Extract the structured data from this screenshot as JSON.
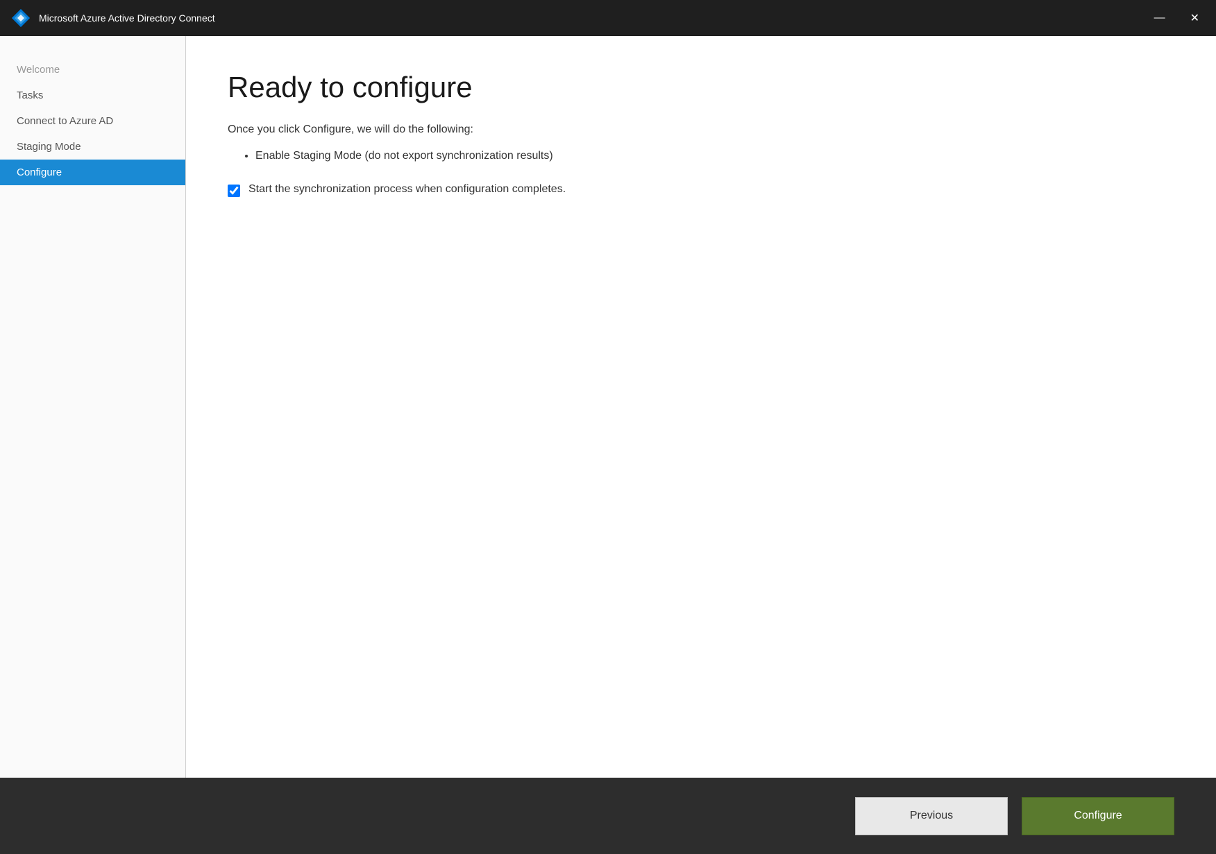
{
  "titlebar": {
    "logo_alt": "Azure AD Connect Logo",
    "title": "Microsoft Azure Active Directory Connect",
    "minimize_label": "—",
    "close_label": "✕"
  },
  "sidebar": {
    "items": [
      {
        "id": "welcome",
        "label": "Welcome",
        "state": "muted"
      },
      {
        "id": "tasks",
        "label": "Tasks",
        "state": "normal"
      },
      {
        "id": "connect-azure-ad",
        "label": "Connect to Azure AD",
        "state": "normal"
      },
      {
        "id": "staging-mode",
        "label": "Staging Mode",
        "state": "normal"
      },
      {
        "id": "configure",
        "label": "Configure",
        "state": "active"
      }
    ]
  },
  "page": {
    "title": "Ready to configure",
    "description": "Once you click Configure, we will do the following:",
    "bullet_items": [
      "Enable Staging Mode (do not export synchronization results)"
    ],
    "checkbox": {
      "label": "Start the synchronization process when configuration completes.",
      "checked": true
    }
  },
  "footer": {
    "previous_label": "Previous",
    "configure_label": "Configure"
  }
}
